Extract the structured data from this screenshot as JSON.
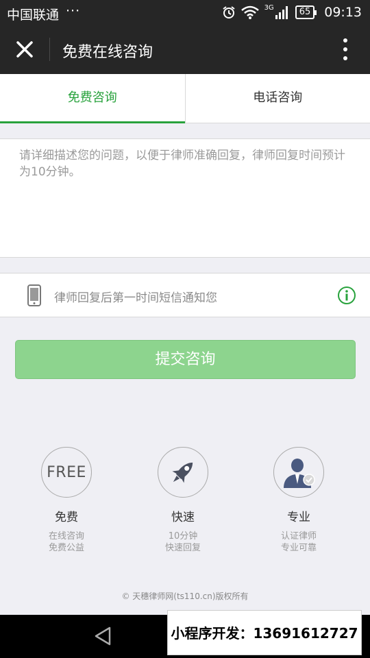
{
  "status_bar": {
    "carrier": "中国联通",
    "dots": "···",
    "network": "3G",
    "battery": "65",
    "time": "09:13"
  },
  "nav": {
    "title": "免费在线咨询"
  },
  "tabs": [
    {
      "label": "免费咨询",
      "active": true
    },
    {
      "label": "电话咨询",
      "active": false
    }
  ],
  "question": {
    "placeholder": "请详细描述您的问题，以便于律师准确回复，律师回复时间预计为10分钟。",
    "value": ""
  },
  "notify": {
    "text": "律师回复后第一时间短信通知您"
  },
  "submit": {
    "label": "提交咨询"
  },
  "features": [
    {
      "icon": "free-icon",
      "icon_text": "FREE",
      "title": "免费",
      "line1": "在线咨询",
      "line2": "免费公益"
    },
    {
      "icon": "rocket-icon",
      "title": "快速",
      "line1": "10分钟",
      "line2": "快速回复"
    },
    {
      "icon": "lawyer-icon",
      "title": "专业",
      "line1": "认证律师",
      "line2": "专业可靠"
    }
  ],
  "copyright": "© 天穗律师网(ts110.cn)版权所有",
  "promo": "小程序开发：13691612727",
  "colors": {
    "accent": "#28a23c",
    "submit_bg": "#8dd48e",
    "bar": "#262626"
  }
}
